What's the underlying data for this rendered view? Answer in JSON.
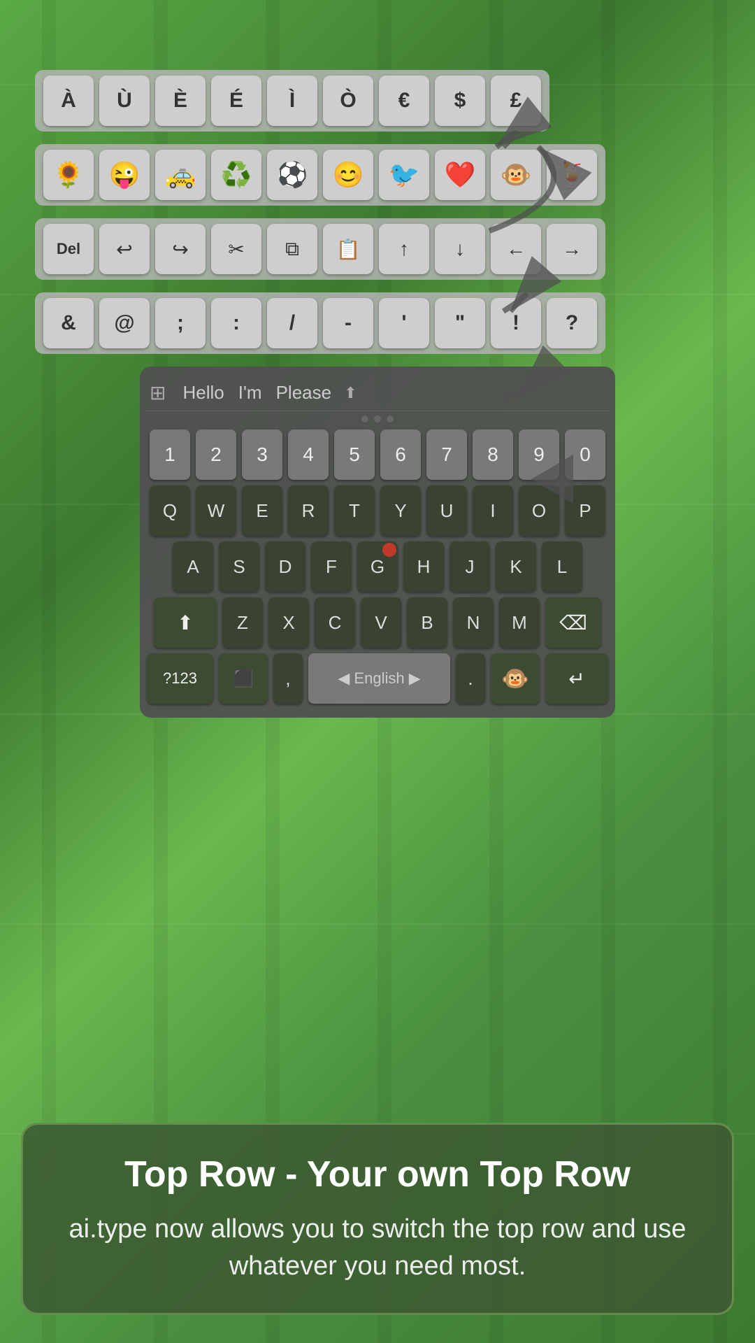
{
  "background": {
    "color": "#4a8a3a"
  },
  "special_chars": {
    "keys": [
      "À",
      "Ù",
      "È",
      "É",
      "Ì",
      "Ò",
      "€",
      "$",
      "£"
    ]
  },
  "emoji_row": {
    "emojis": [
      "🌻",
      "😜",
      "🚕",
      "♻️",
      "⚽",
      "😊",
      "🐦",
      "❤️",
      "🐵",
      "🍹"
    ]
  },
  "edit_row": {
    "keys": [
      "Del",
      "↩",
      "↪",
      "✂",
      "⧉",
      "📋",
      "↑",
      "↓",
      "←",
      "→"
    ]
  },
  "punct_row": {
    "keys": [
      "&",
      "@",
      ";",
      ":",
      "/",
      "-",
      "'",
      "\"",
      "!",
      "?"
    ]
  },
  "suggestions": {
    "items": [
      "Hello",
      "I'm",
      "Please"
    ]
  },
  "keyboard": {
    "number_row": [
      "1",
      "2",
      "3",
      "4",
      "5",
      "6",
      "7",
      "8",
      "9",
      "0"
    ],
    "row1": [
      "Q",
      "W",
      "E",
      "R",
      "T",
      "Y",
      "U",
      "I",
      "O",
      "P"
    ],
    "row2": [
      "A",
      "S",
      "D",
      "F",
      "G",
      "H",
      "J",
      "K",
      "L"
    ],
    "row3": [
      "Z",
      "X",
      "C",
      "V",
      "B",
      "N",
      "M"
    ],
    "shift_label": "⬆",
    "backspace_label": "⌫",
    "numbers_label": "?123",
    "language_label": "English",
    "language_prev": "◀",
    "language_next": "▶",
    "comma_label": ",",
    "period_label": ".",
    "enter_label": "↵",
    "emoji_label": "🐵",
    "layout_label": "⬛"
  },
  "swipe_dots": {
    "dots": [
      true,
      true,
      false,
      false,
      false
    ]
  },
  "info_box": {
    "title": "Top Row - Your own Top Row",
    "description": "ai.type now allows you to switch the top row\nand use whatever you need most."
  }
}
